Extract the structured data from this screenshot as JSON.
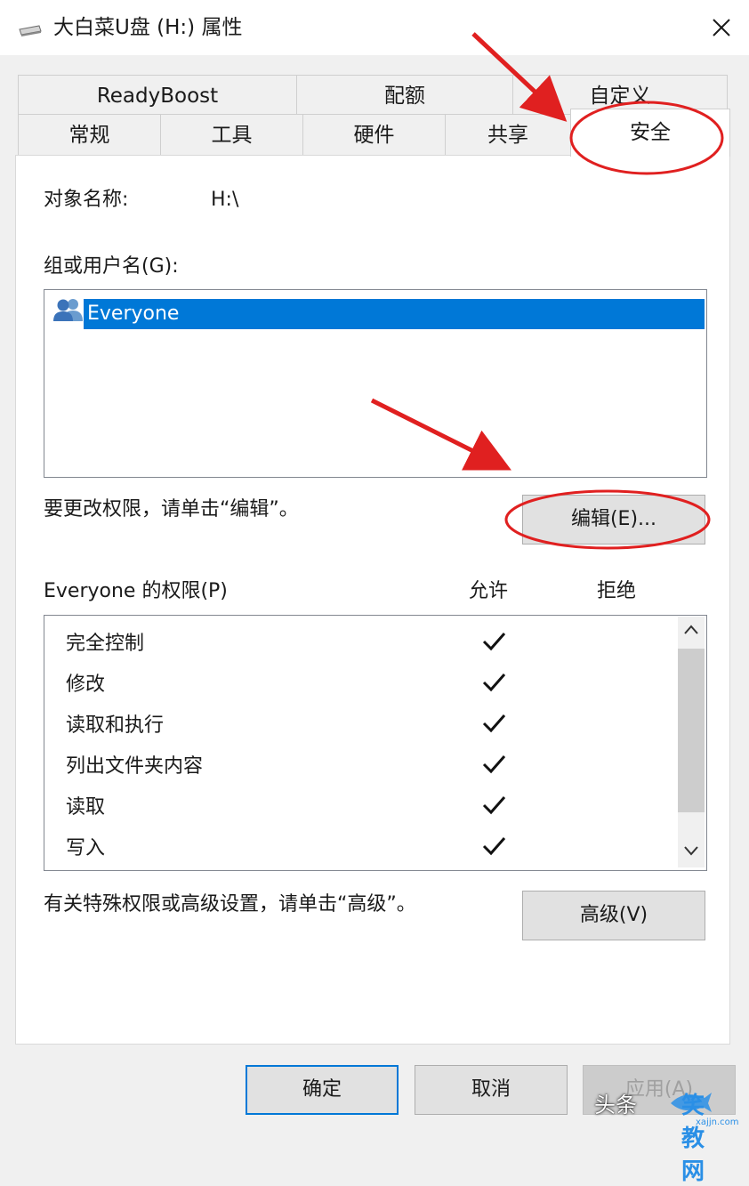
{
  "window": {
    "title": "大白菜U盘 (H:) 属性",
    "close_glyph": "✕"
  },
  "tabs": {
    "row1": [
      "ReadyBoost",
      "配额",
      "自定义"
    ],
    "row2": [
      "常规",
      "工具",
      "硬件",
      "共享",
      "安全"
    ],
    "active": "安全"
  },
  "security": {
    "object_name_label": "对象名称:",
    "object_name_value": "H:\\",
    "groups_label": "组或用户名(G):",
    "groups": [
      {
        "name": "Everyone",
        "icon": "users-icon",
        "selected": true
      }
    ],
    "change_hint": "要更改权限，请单击“编辑”。",
    "edit_button": "编辑(E)...",
    "permissions_label": "Everyone 的权限(P)",
    "allow_header": "允许",
    "deny_header": "拒绝",
    "permissions": [
      {
        "name": "完全控制",
        "allow": true,
        "deny": false
      },
      {
        "name": "修改",
        "allow": true,
        "deny": false
      },
      {
        "name": "读取和执行",
        "allow": true,
        "deny": false
      },
      {
        "name": "列出文件夹内容",
        "allow": true,
        "deny": false
      },
      {
        "name": "读取",
        "allow": true,
        "deny": false
      },
      {
        "name": "写入",
        "allow": true,
        "deny": false
      }
    ],
    "advanced_hint": "有关特殊权限或高级设置，请单击“高级”。",
    "advanced_button": "高级(V)"
  },
  "footer": {
    "ok_button": "确定",
    "cancel_button": "取消",
    "apply_button": "应用(A)"
  },
  "watermark": {
    "source": "头条",
    "brand": "笑教网",
    "url": "xajjn.com"
  },
  "colors": {
    "selection": "#0078d7",
    "annotation": "#e02020"
  }
}
